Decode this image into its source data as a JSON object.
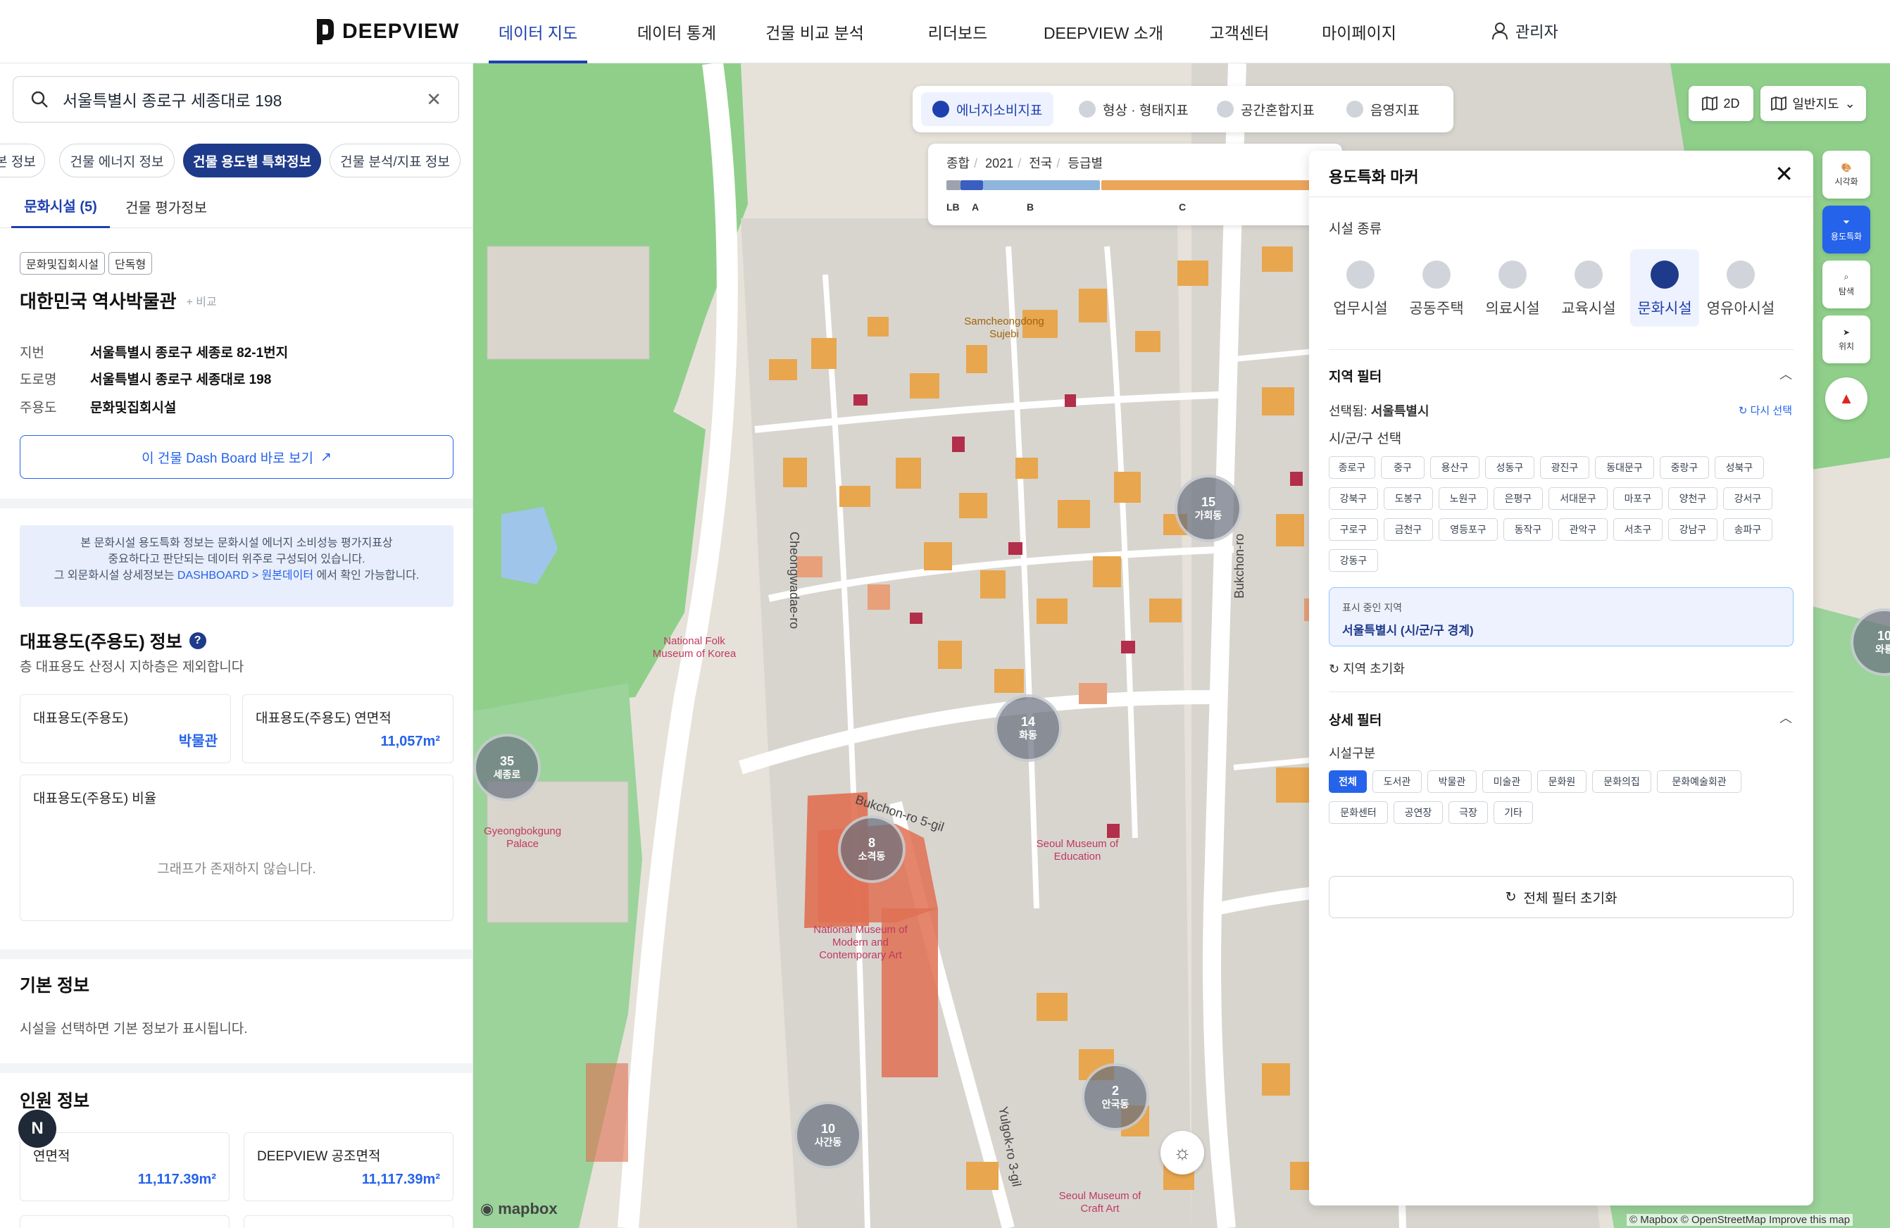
{
  "header": {
    "logo": "DEEPVIEW",
    "nav": [
      "데이터 지도",
      "데이터 통계",
      "건물 비교 분석",
      "리더보드",
      "DEEPVIEW 소개",
      "고객센터",
      "마이페이지"
    ],
    "active_nav": "데이터 지도",
    "user": "관리자"
  },
  "left_panel": {
    "search_value": "서울특별시 종로구 세종대로 198",
    "info_tabs": [
      "본 정보",
      "건물 에너지 정보",
      "건물 용도별 특화정보",
      "건물 분석/지표 정보"
    ],
    "active_info_tab": "건물 용도별 특화정보",
    "sub_tabs": [
      "문화시설 (5)",
      "건물 평가정보"
    ],
    "active_sub_tab": "문화시설 (5)",
    "tags": [
      "문화및집회시설",
      "단독형"
    ],
    "building_name": "대한민국 역사박물관",
    "compare_label": "+ 비교",
    "details": [
      {
        "key": "지번",
        "value": "서울특별시 종로구 세종로 82-1번지"
      },
      {
        "key": "도로명",
        "value": "서울특별시 종로구 세종대로 198"
      },
      {
        "key": "주용도",
        "value": "문화및집회시설"
      }
    ],
    "dashboard_button": "이 건물 Dash Board 바로 보기",
    "notice": {
      "line1": "본 문화시설 용도특화 정보는 문화시설 에너지 소비성능 평가지표상",
      "line2": "중요하다고 판단되는 데이터 위주로 구성되어 있습니다.",
      "line3_pre": "그 외문화시설 상세정보는 ",
      "line3_link": "DASHBOARD > 원본데이터",
      "line3_post": " 에서 확인 가능합니다."
    },
    "main_use": {
      "title": "대표용도(주용도) 정보",
      "subtitle": "층 대표용도 산정시 지하층은 제외합니다",
      "card1_label": "대표용도(주용도)",
      "card1_value": "박물관",
      "card2_label": "대표용도(주용도) 연면적",
      "card2_value": "11,057m²",
      "ratio_label": "대표용도(주용도) 비율",
      "ratio_empty": "그래프가 존재하지 않습니다."
    },
    "basic_info": {
      "title": "기본 정보",
      "text": "시설을 선택하면 기본 정보가 표시됩니다."
    },
    "personnel": {
      "title": "인원 정보",
      "card1_label": "연면적",
      "card1_value": "11,117.39m²",
      "card2_label": "DEEPVIEW 공조면적",
      "card2_value": "11,117.39m²"
    },
    "fab_label": "N"
  },
  "map": {
    "tabs": [
      "에너지소비지표",
      "형상 · 형태지표",
      "공간혼합지표",
      "음영지표"
    ],
    "active_tab": "에너지소비지표",
    "grade": {
      "crumbs": [
        "종합",
        "2021",
        "전국",
        "등급별"
      ],
      "labels": [
        "LB",
        "A",
        "B",
        "C"
      ]
    },
    "view_button": "2D",
    "maptype_button": "일반지도",
    "clusters": [
      {
        "count": "35",
        "name": "세종로"
      },
      {
        "count": "15",
        "name": "가회동"
      },
      {
        "count": "14",
        "name": "화동"
      },
      {
        "count": "8",
        "name": "소격동"
      },
      {
        "count": "2",
        "name": "안국동"
      },
      {
        "count": "10",
        "name": "사간동"
      },
      {
        "count": "10",
        "name": "와룡"
      }
    ],
    "labels": {
      "road1": "Cheongwadae-ro",
      "road2": "Bukchon-ro",
      "road3": "Bukchon-ro 5-gil",
      "road4": "Yulgok-ro 3-gil",
      "poi1": "National Folk Museum of Korea",
      "poi2": "National Museum of Modern and Contemporary Art",
      "poi3": "Seoul Museum of Education",
      "poi4": "Seoul Museum of Craft Art",
      "poi5": "Gyeongbokgung Palace",
      "poi6": "Samcheongdong Sujebi"
    },
    "attribution": "© Mapbox © OpenStreetMap  Improve this map",
    "mapbox": "mapbox",
    "side_buttons": [
      "시각화",
      "용도특화",
      "탐색",
      "위치"
    ],
    "active_side": "용도특화"
  },
  "right_panel": {
    "title": "용도특화 마커",
    "facility_type_label": "시설 종류",
    "facilities": [
      "업무시설",
      "공동주택",
      "의료시설",
      "교육시설",
      "문화시설",
      "영유아시설"
    ],
    "active_facility": "문화시설",
    "region_filter": "지역 필터",
    "selected_label": "선택됨:",
    "selected_value": "서울특별시",
    "reselect": "다시 선택",
    "district_label": "시/군/구 선택",
    "districts": [
      "종로구",
      "중구",
      "용산구",
      "성동구",
      "광진구",
      "동대문구",
      "중랑구",
      "성북구",
      "강북구",
      "도봉구",
      "노원구",
      "은평구",
      "서대문구",
      "마포구",
      "양천구",
      "강서구",
      "구로구",
      "금천구",
      "영등포구",
      "동작구",
      "관악구",
      "서초구",
      "강남구",
      "송파구",
      "강동구"
    ],
    "display_region_label": "표시 중인 지역",
    "display_region_value": "서울특별시 (시/군/구 경계)",
    "region_reset": "지역 초기화",
    "detail_filter": "상세 필터",
    "facility_class_label": "시설구분",
    "classes": [
      "전체",
      "도서관",
      "박물관",
      "미술관",
      "문화원",
      "문화의집",
      "문화예술회관",
      "문화센터",
      "공연장",
      "극장",
      "기타"
    ],
    "active_class": "전체",
    "reset_all": "전체 필터 초기화"
  }
}
